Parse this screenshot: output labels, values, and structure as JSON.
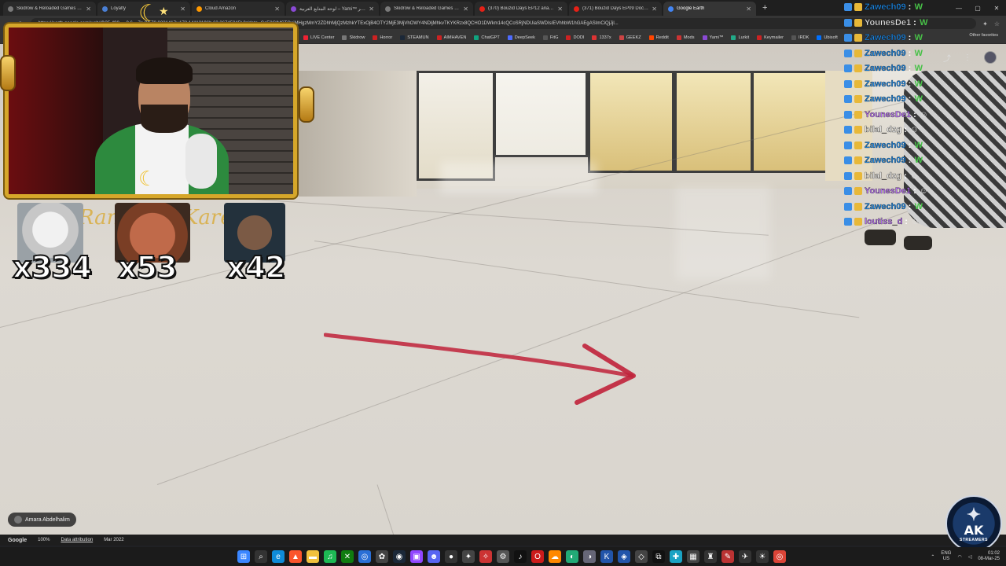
{
  "tabs": [
    {
      "title": "Skidrow & Reloaded Games – Do",
      "color": "#7a7a7a",
      "active": false
    },
    {
      "title": "Loyalty",
      "color": "#4a7fd4",
      "active": false
    },
    {
      "title": "Cloud Amazon",
      "color": "#ff9900",
      "active": false
    },
    {
      "title": "لوحة المتابع العربية – Yami™ سحر",
      "color": "#8a4ad4",
      "active": false
    },
    {
      "title": "Skidrow & Reloaded Games – Do",
      "color": "#7a7a7a",
      "active": false
    },
    {
      "title": "(370) Bouzid Days EP12 analyses",
      "color": "#e62117",
      "active": false
    },
    {
      "title": "(371) Bouzid Days EP09 Docteur p",
      "color": "#e62117",
      "active": false
    },
    {
      "title": "Google Earth",
      "color": "#4285f4",
      "active": true
    }
  ],
  "address_bar": {
    "url": "https://earth.google.com/web/@35.498...,-0.6...,7a,0d,70.0231417y,172.14113196h,63.36745045t,0r/data=CoE8GlMSTQoiMHgzMmY2ZDhhMjQzMzhkYTExOjB4OTY2MjE3MjVhOWY4NDljMhkvTKYKRzx8QCHO1DWkm14cQCoSRjNDUiaSWDIsIEVhhbW1hGAEgASImCiQjJjl..."
  },
  "bookmarks": [
    {
      "label": "LIVE Center",
      "color": "#e23"
    },
    {
      "label": "Skidrow",
      "color": "#777"
    },
    {
      "label": "Horror",
      "color": "#c22"
    },
    {
      "label": "STEAMUN",
      "color": "#1b2838"
    },
    {
      "label": "AIMHAVEN",
      "color": "#c22"
    },
    {
      "label": "ChatGPT",
      "color": "#10a37f"
    },
    {
      "label": "DeepSeek",
      "color": "#4d6bfe"
    },
    {
      "label": "FitG",
      "color": "#555"
    },
    {
      "label": "DODI",
      "color": "#c22"
    },
    {
      "label": "1337x",
      "color": "#d33"
    },
    {
      "label": "GEEKZ",
      "color": "#c44"
    },
    {
      "label": "Reddit",
      "color": "#ff4500"
    },
    {
      "label": "Mods",
      "color": "#c33"
    },
    {
      "label": "Yami™",
      "color": "#8a4ad4"
    },
    {
      "label": "Lurkit",
      "color": "#2a8"
    },
    {
      "label": "Keymailer",
      "color": "#c22"
    },
    {
      "label": "IRDK",
      "color": "#555"
    },
    {
      "label": "Ubisoft",
      "color": "#0070ff"
    }
  ],
  "other_favorites": "Other favorites",
  "overlay": {
    "cursive_text": "Ramadan Kareem",
    "emotes": [
      {
        "name": "cat-emote",
        "count": "x334"
      },
      {
        "name": "laughing-face-emote",
        "count": "x53"
      },
      {
        "name": "bearded-man-emote",
        "count": "x42"
      }
    ]
  },
  "chat": [
    {
      "user": "Zawech09",
      "color": "#1e8ae8",
      "emote": "W"
    },
    {
      "user": "YounesDe1",
      "color": "#e8e8e8",
      "emote": "W"
    },
    {
      "user": "Zawech09",
      "color": "#1e8ae8",
      "emote": "W"
    },
    {
      "user": "Zawech09",
      "color": "#1e8ae8",
      "emote": "W"
    },
    {
      "user": "Zawech09",
      "color": "#1e8ae8",
      "emote": "W"
    },
    {
      "user": "Zawech09",
      "color": "#1e8ae8",
      "emote": "W"
    },
    {
      "user": "Zawech09",
      "color": "#1e8ae8",
      "emote": "W"
    },
    {
      "user": "YounesDe1",
      "color": "#b36cf0",
      "emote": "☺"
    },
    {
      "user": "bilal_dzg",
      "color": "#e8e8e8",
      "emote": "☺"
    },
    {
      "user": "Zawech09",
      "color": "#1e8ae8",
      "emote": "W"
    },
    {
      "user": "Zawech09",
      "color": "#1e8ae8",
      "emote": "W"
    },
    {
      "user": "bilal_dzg",
      "color": "#e8e8e8",
      "emote": "☺"
    },
    {
      "user": "YounesDe1",
      "color": "#b36cf0",
      "emote": "☺"
    },
    {
      "user": "Zawech09",
      "color": "#1e8ae8",
      "emote": "W"
    },
    {
      "user": "loutiss_d",
      "color": "#b36cf0",
      "emote": "☺"
    }
  ],
  "attribution": {
    "author": "Amara Abdelhalim"
  },
  "earth_footer": {
    "brand": "Google",
    "zoom": "100%",
    "data_attribution": "Data attribution",
    "date": "Mar 2022"
  },
  "stream_logo": {
    "title": "AK",
    "subtitle": "STREAMERS"
  },
  "taskbar": {
    "lang_top": "ENG",
    "lang_bottom": "US",
    "time": "01:02",
    "date": "08-Mar-25",
    "apps": [
      {
        "name": "windows-start-icon",
        "color": "#3a86ff",
        "glyph": "⊞"
      },
      {
        "name": "search-icon",
        "color": "#333",
        "glyph": "⌕"
      },
      {
        "name": "edge-icon",
        "color": "#0f8bd8",
        "glyph": "e"
      },
      {
        "name": "brave-icon",
        "color": "#fb542b",
        "glyph": "▲"
      },
      {
        "name": "explorer-icon",
        "color": "#f2c13d",
        "glyph": "▬"
      },
      {
        "name": "spotify-icon",
        "color": "#1db954",
        "glyph": "♫"
      },
      {
        "name": "xbox-icon",
        "color": "#107c10",
        "glyph": "✕"
      },
      {
        "name": "globe-icon",
        "color": "#2a6fd6",
        "glyph": "◎"
      },
      {
        "name": "chatgpt-icon",
        "color": "#444",
        "glyph": "✿"
      },
      {
        "name": "steam-icon",
        "color": "#1b2838",
        "glyph": "◉"
      },
      {
        "name": "twitch-icon",
        "color": "#9146ff",
        "glyph": "▣"
      },
      {
        "name": "discord-icon",
        "color": "#5865f2",
        "glyph": "☻"
      },
      {
        "name": "obs-icon",
        "color": "#333",
        "glyph": "●"
      },
      {
        "name": "app-icon",
        "color": "#444",
        "glyph": "✦"
      },
      {
        "name": "app-icon-2",
        "color": "#c33",
        "glyph": "✧"
      },
      {
        "name": "settings-icon",
        "color": "#555",
        "glyph": "⚙"
      },
      {
        "name": "tiktok-icon",
        "color": "#111",
        "glyph": "♪"
      },
      {
        "name": "opera-icon",
        "color": "#cc1b1b",
        "glyph": "O"
      },
      {
        "name": "cloud-icon",
        "color": "#f80",
        "glyph": "☁"
      },
      {
        "name": "app-icon-3",
        "color": "#2a7",
        "glyph": "◐"
      },
      {
        "name": "app-icon-4",
        "color": "#667",
        "glyph": "◑"
      },
      {
        "name": "kde-icon",
        "color": "#2255aa",
        "glyph": "K"
      },
      {
        "name": "app-icon-5",
        "color": "#2255aa",
        "glyph": "◈"
      },
      {
        "name": "app-icon-6",
        "color": "#444",
        "glyph": "◇"
      },
      {
        "name": "capcut-icon",
        "color": "#111",
        "glyph": "⧉"
      },
      {
        "name": "app-icon-7",
        "color": "#1aa3c4",
        "glyph": "✚"
      },
      {
        "name": "app-icon-8",
        "color": "#444",
        "glyph": "▦"
      },
      {
        "name": "app-icon-9",
        "color": "#333",
        "glyph": "♜"
      },
      {
        "name": "app-icon-10",
        "color": "#b33",
        "glyph": "✎"
      },
      {
        "name": "app-icon-11",
        "color": "#333",
        "glyph": "✈"
      },
      {
        "name": "app-icon-12",
        "color": "#333",
        "glyph": "☀"
      },
      {
        "name": "chrome-icon",
        "color": "#db4437",
        "glyph": "◎"
      }
    ]
  }
}
